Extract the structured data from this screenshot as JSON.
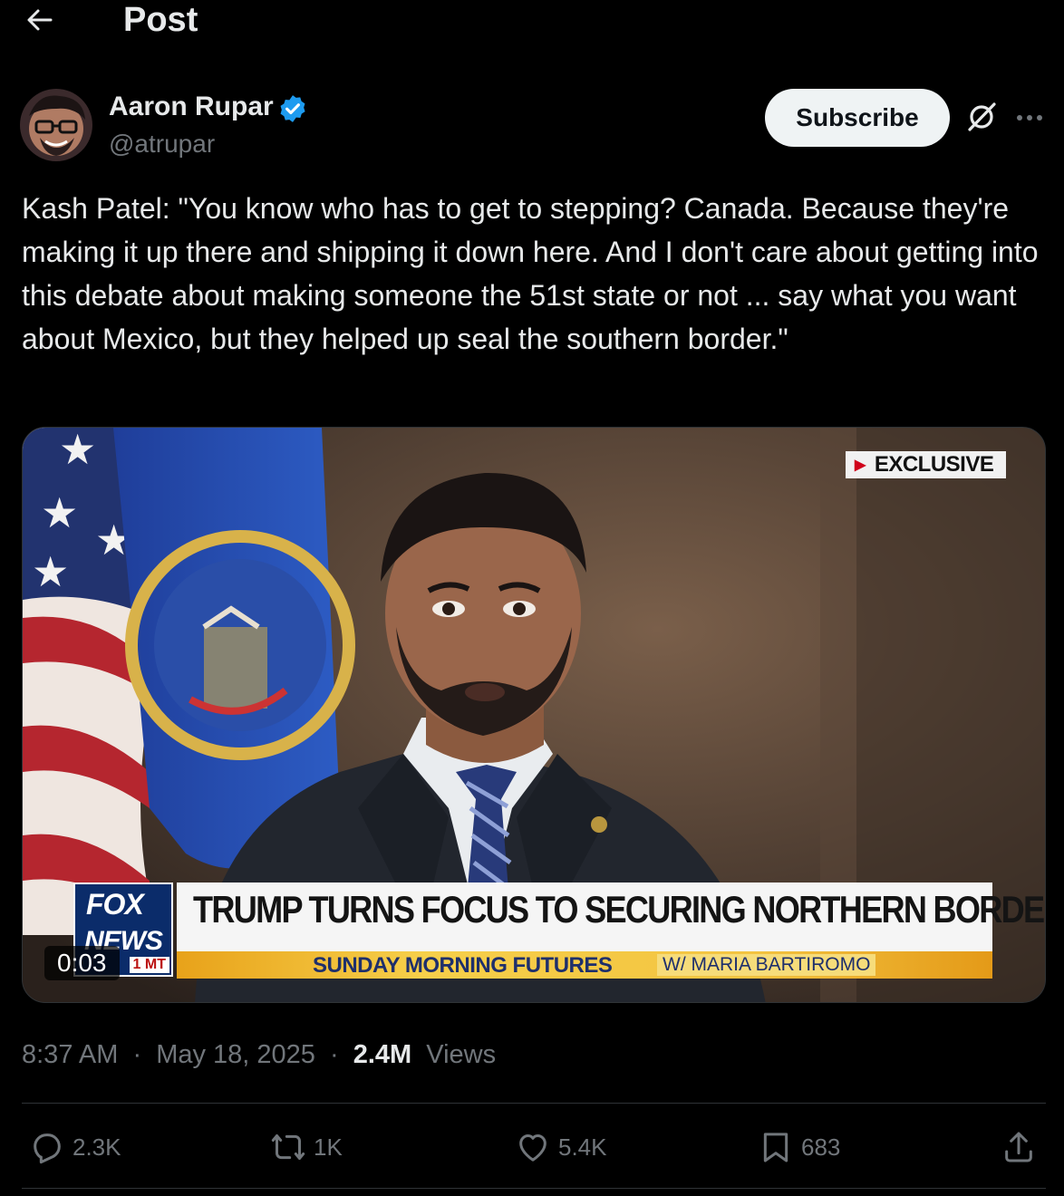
{
  "header": {
    "title": "Post"
  },
  "author": {
    "name": "Aaron Rupar",
    "handle": "@atrupar",
    "verified": true
  },
  "actions_top": {
    "subscribe_label": "Subscribe"
  },
  "tweet": {
    "text": "Kash Patel: \"You know who has to get to stepping? Canada. Because they're making it up there and shipping it down here. And I don't care about getting into this debate about making someone the 51st state or not ... say what you want about Mexico, but they helped up seal the southern border.\""
  },
  "video": {
    "badge": "EXCLUSIVE",
    "logo_top": "FOX",
    "logo_bottom": "NEWS",
    "logo_tag": "1 MT",
    "headline": "TRUMP TURNS FOCUS TO SECURING NORTHERN BORDER",
    "show_name": "SUNDAY MORNING FUTURES",
    "host": "W/ MARIA BARTIROMO",
    "time": "0:03"
  },
  "meta": {
    "time": "8:37 AM",
    "date": "May 18, 2025",
    "views_count": "2.4M",
    "views_label": "Views",
    "separator": "·"
  },
  "stats": {
    "replies": "2.3K",
    "reposts": "1K",
    "likes": "5.4K",
    "bookmarks": "683"
  },
  "colors": {
    "background": "#000000",
    "text": "#e7e9ea",
    "muted": "#71767b",
    "verified": "#1d9bf0",
    "divider": "#2f3336"
  },
  "icons": [
    "back-arrow-icon",
    "verified-badge-icon",
    "grok-icon",
    "more-icon",
    "reply-icon",
    "repost-icon",
    "like-icon",
    "bookmark-icon",
    "share-icon"
  ]
}
